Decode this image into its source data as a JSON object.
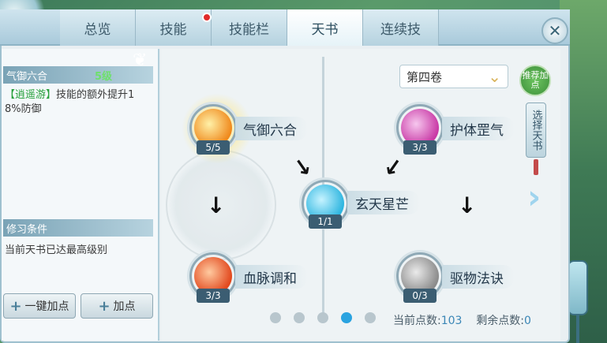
{
  "tabs": [
    {
      "label": "总览"
    },
    {
      "label": "技能"
    },
    {
      "label": "技能栏"
    },
    {
      "label": "天书"
    },
    {
      "label": "连续技"
    }
  ],
  "active_tab": "天书",
  "left_panel": {
    "skill_name": "气御六合",
    "skill_level": "5级",
    "desc_prefix": "【逍遥游】",
    "desc_line1": "技能的额外提升1",
    "desc_line2": "8%防御",
    "requirement_title": "修习条件",
    "requirement_text": "当前天书已达最高级别",
    "btn_one_key": "一键加点",
    "btn_add": "加点"
  },
  "book": {
    "volume": "第四卷",
    "recommend": "推荐加点",
    "select": "选择天书"
  },
  "nodes": [
    {
      "name": "气御六合",
      "count": "5/5",
      "color": "#f08a1d"
    },
    {
      "name": "护体罡气",
      "count": "3/3",
      "color": "#c93aa6"
    },
    {
      "name": "玄天星芒",
      "count": "1/1",
      "color": "#2fb6e0"
    },
    {
      "name": "血脉调和",
      "count": "3/3",
      "color": "#e2491e"
    },
    {
      "name": "驱物法诀",
      "count": "0/3",
      "color": "#9a9a9a"
    }
  ],
  "points": {
    "current_label": "当前点数:",
    "current_value": "103",
    "remaining_label": "剩余点数:",
    "remaining_value": "0"
  },
  "pagination": {
    "pages": 5,
    "active_index": 3
  },
  "icons": {
    "close": "close-icon",
    "arrow": "down-arrow-icon",
    "next": "chevron-right-icon"
  }
}
